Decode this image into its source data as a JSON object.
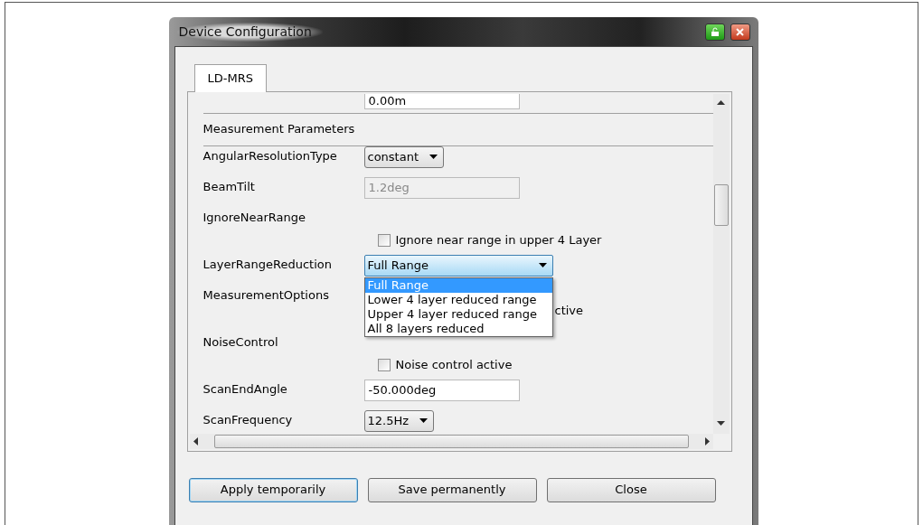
{
  "window": {
    "title": "Device Configuration"
  },
  "tabs": [
    {
      "label": "LD-MRS",
      "selected": true
    }
  ],
  "rows": [
    {
      "kind": "text",
      "value": "0.00m",
      "disabled": false
    },
    {
      "kind": "section",
      "label": "Measurement Parameters"
    },
    {
      "kind": "combo",
      "label": "AngularResolutionType",
      "value": "constant",
      "expanded": false
    },
    {
      "kind": "text",
      "label": "BeamTilt",
      "value": "1.2deg",
      "disabled": true
    },
    {
      "kind": "checkbox",
      "label": "IgnoreNearRange",
      "text": "Ignore near range in upper 4 Layer",
      "checked": false
    },
    {
      "kind": "combo",
      "label": "LayerRangeReduction",
      "value": "Full Range",
      "expanded": true,
      "options": [
        {
          "label": "Full Range",
          "selected": true
        },
        {
          "label": "Lower 4 layer reduced range",
          "selected": false
        },
        {
          "label": "Upper 4 layer reduced range",
          "selected": false
        },
        {
          "label": "All 8 layers reduced",
          "selected": false
        }
      ]
    },
    {
      "kind": "covered",
      "label": "MeasurementOptions",
      "text": "ctive"
    },
    {
      "kind": "checkbox",
      "label": "NoiseControl",
      "text": "Noise control active",
      "checked": false
    },
    {
      "kind": "text",
      "label": "ScanEndAngle",
      "value": "-50.000deg",
      "disabled": false
    },
    {
      "kind": "combo",
      "label": "ScanFrequency",
      "value": "12.5Hz",
      "expanded": false
    }
  ],
  "buttons": [
    {
      "label": "Apply temporarily",
      "focused": true
    },
    {
      "label": "Save permanently",
      "focused": false
    },
    {
      "label": "Close",
      "focused": false
    }
  ]
}
